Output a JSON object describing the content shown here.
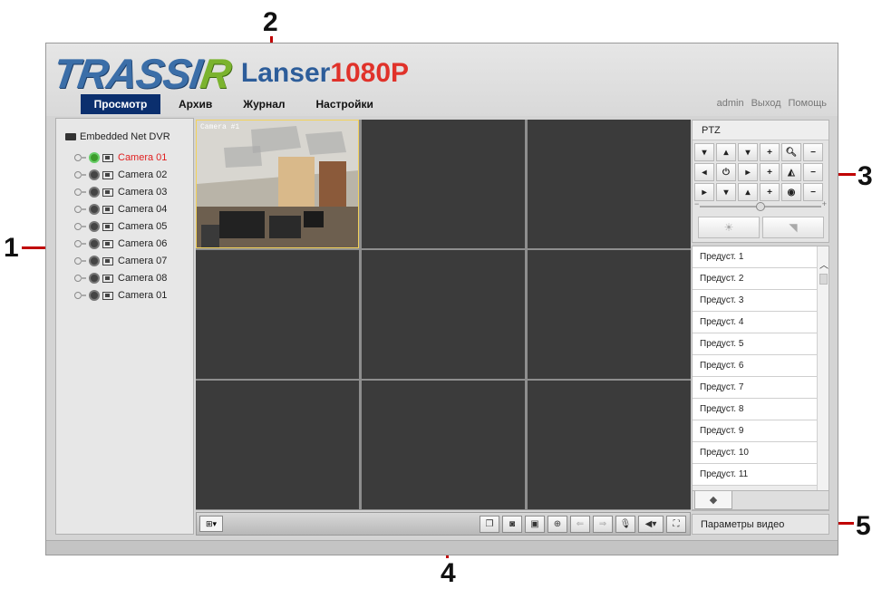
{
  "logo": {
    "brand": "TRASSIR",
    "product": "Lanser",
    "model": "1080P"
  },
  "nav": {
    "tabs": [
      "Просмотр",
      "Архив",
      "Журнал",
      "Настройки"
    ],
    "active": "Просмотр"
  },
  "user": {
    "name": "admin",
    "logout": "Выход",
    "help": "Помощь"
  },
  "tree": {
    "root": "Embedded Net DVR",
    "cameras": [
      "Camera 01",
      "Camera 02",
      "Camera 03",
      "Camera 04",
      "Camera 05",
      "Camera 06",
      "Camera 07",
      "Camera 08",
      "Camera 01"
    ],
    "selected_index": 0
  },
  "grid": {
    "live_overlay": "Camera #1"
  },
  "ptz": {
    "title": "PTZ"
  },
  "presets": [
    "Предуст. 1",
    "Предуст. 2",
    "Предуст. 3",
    "Предуст. 4",
    "Предуст. 5",
    "Предуст. 6",
    "Предуст. 7",
    "Предуст. 8",
    "Предуст. 9",
    "Предуст. 10",
    "Предуст. 11"
  ],
  "video_params": "Параметры видео",
  "callouts": [
    "1",
    "2",
    "3",
    "4",
    "5"
  ],
  "colors": {
    "nav_active": "#0b2f6e",
    "selected_camera": "#e02020",
    "callout_line": "#c00000",
    "brand_blue": "#3b6ea8",
    "brand_green": "#7bb32e",
    "brand_red": "#e0322a"
  }
}
